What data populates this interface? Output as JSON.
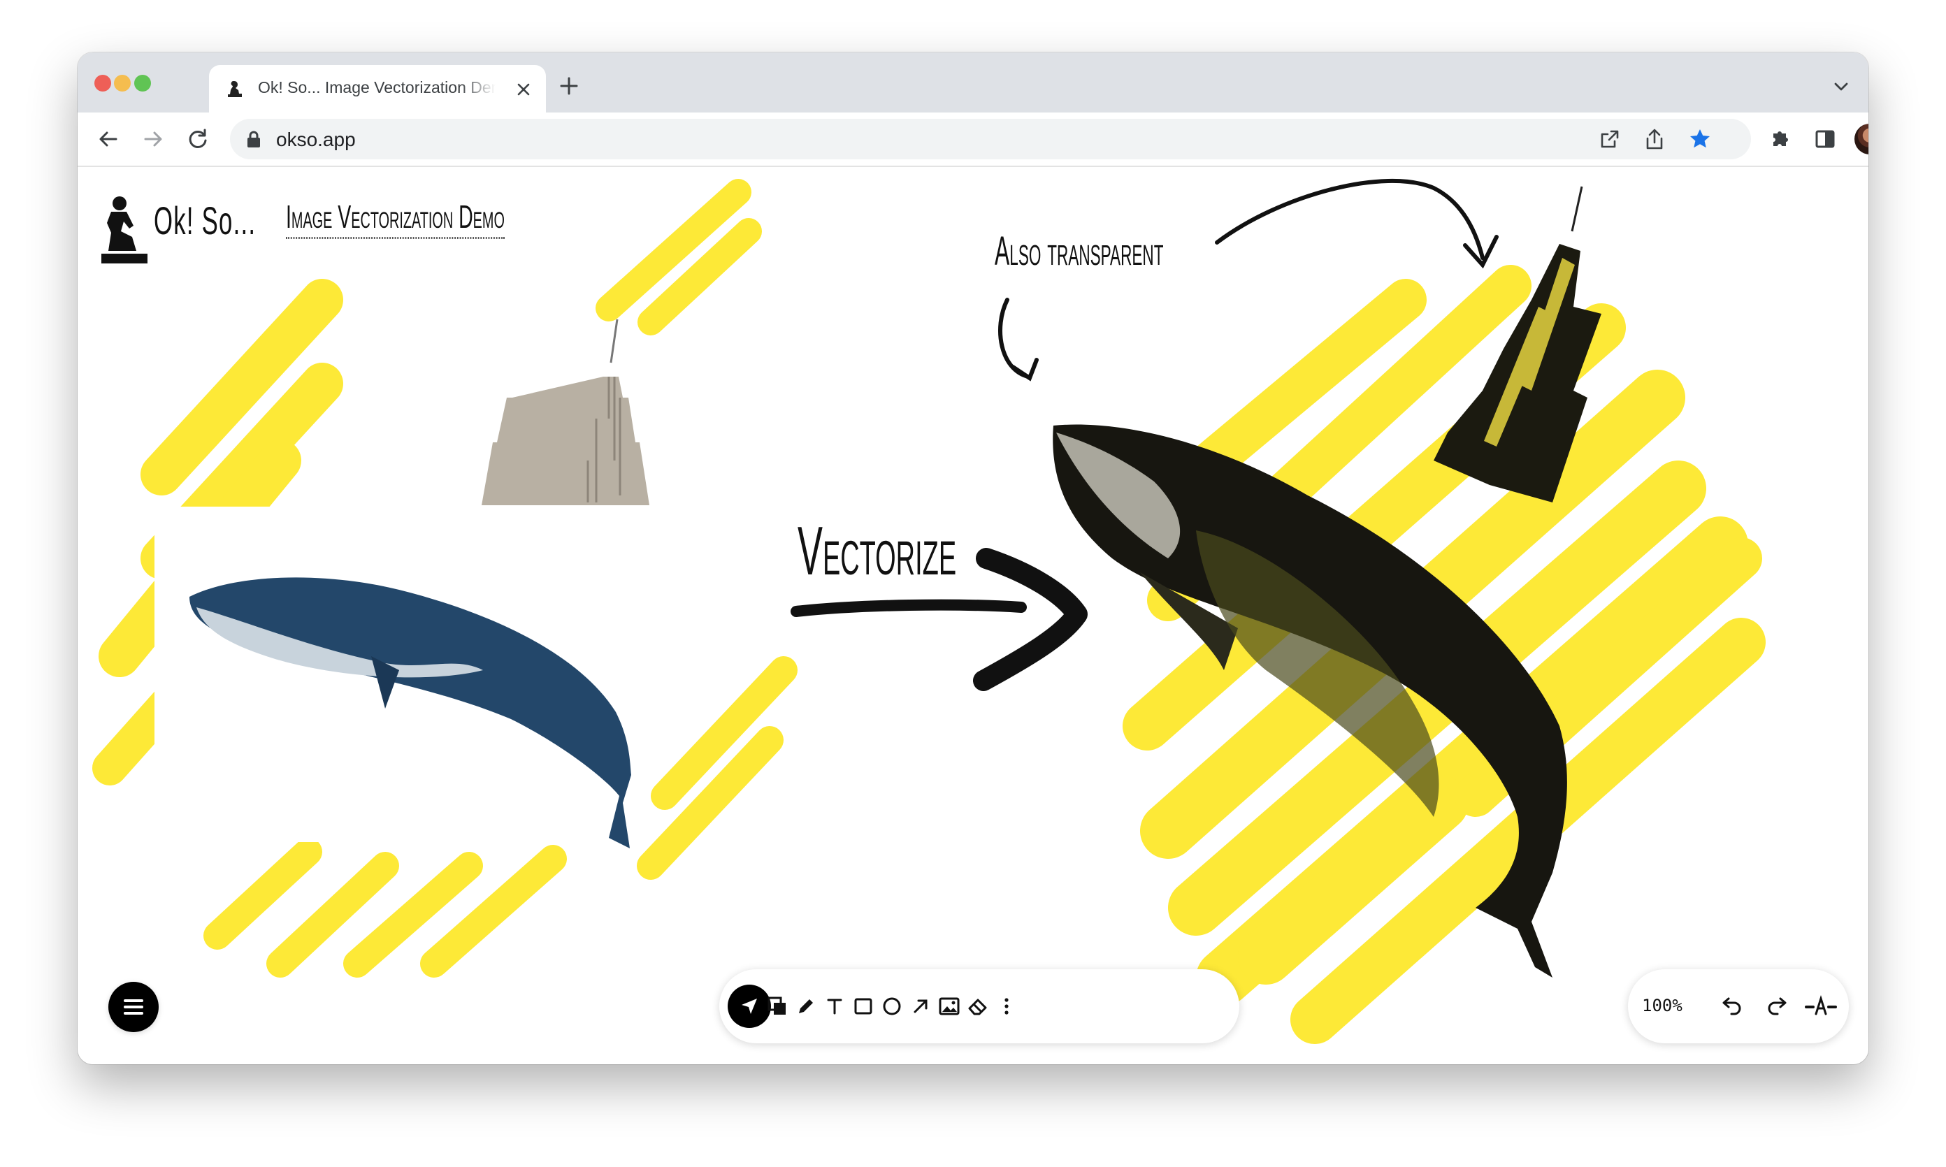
{
  "browser": {
    "tab": {
      "title": "Ok! So... Image Vectorization Demo"
    },
    "address_bar": {
      "url": "okso.app"
    }
  },
  "app": {
    "logo_text": "Ok! So...",
    "demo_title": "Image Vectorization Demo"
  },
  "canvas": {
    "arrow_label": "Vectorize",
    "transparent_label": "Also transparent",
    "highlight_color": "#fde937"
  },
  "toolbar": {
    "tools": [
      "select-tool",
      "layers-tool",
      "pencil-tool",
      "text-tool",
      "rectangle-tool",
      "ellipse-tool",
      "arrow-tool",
      "image-tool",
      "eraser-tool",
      "more-tool"
    ],
    "active_tool": "select-tool"
  },
  "zoom": {
    "level": "100%"
  }
}
